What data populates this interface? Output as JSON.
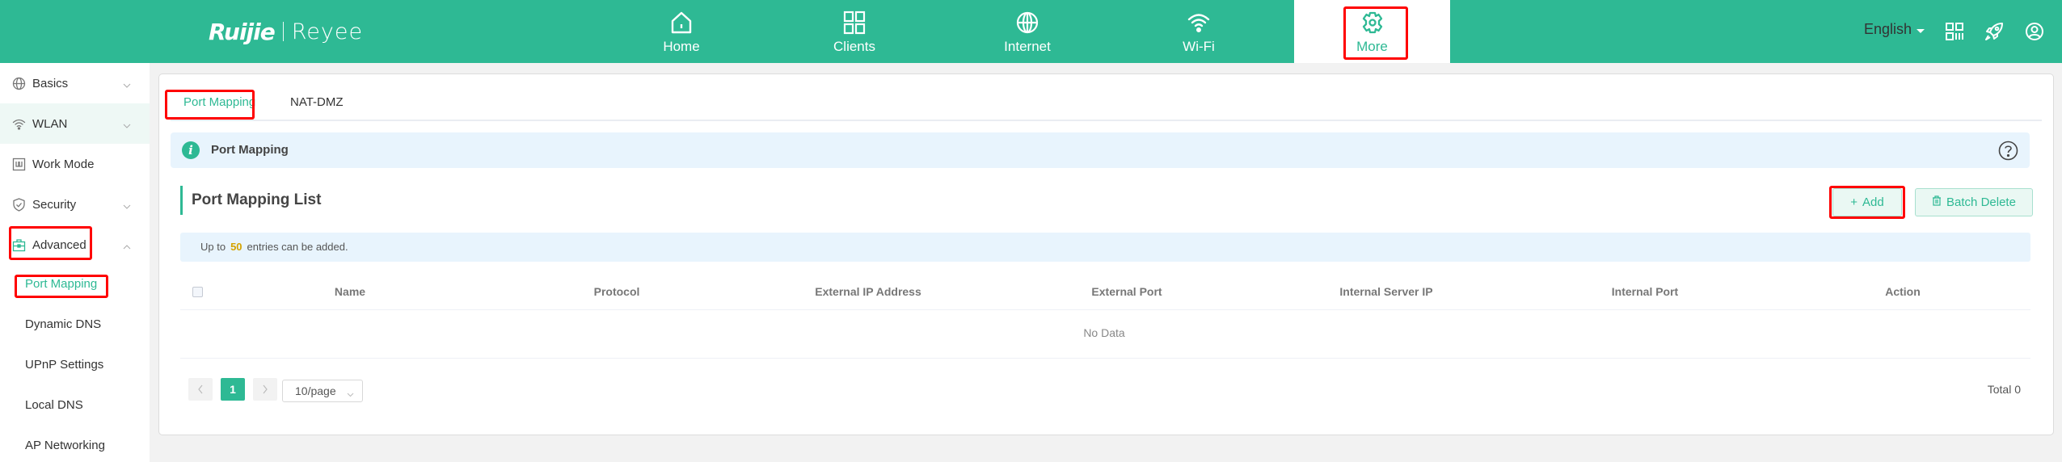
{
  "header": {
    "brand_primary": "Ruijie",
    "brand_secondary": "Reyee",
    "nav": [
      {
        "label": "Home",
        "icon": "home-icon"
      },
      {
        "label": "Clients",
        "icon": "clients-grid-icon"
      },
      {
        "label": "Internet",
        "icon": "globe-icon"
      },
      {
        "label": "Wi-Fi",
        "icon": "wifi-icon"
      },
      {
        "label": "More",
        "icon": "gear-icon",
        "active": true
      }
    ],
    "language": "English",
    "right_icons": [
      "qr-code-icon",
      "rocket-icon",
      "user-icon"
    ]
  },
  "sidebar": {
    "items": [
      {
        "label": "Basics",
        "icon": "globe-icon",
        "expandable": true,
        "expanded": false
      },
      {
        "label": "WLAN",
        "icon": "wifi-icon",
        "expandable": true,
        "expanded": false,
        "hovered": true
      },
      {
        "label": "Work Mode",
        "icon": "work-mode-icon",
        "expandable": false
      },
      {
        "label": "Security",
        "icon": "shield-icon",
        "expandable": true,
        "expanded": false
      },
      {
        "label": "Advanced",
        "icon": "toolbox-icon",
        "expandable": true,
        "expanded": true
      }
    ],
    "sub_items": [
      {
        "label": "Port Mapping",
        "active": true
      },
      {
        "label": "Dynamic DNS"
      },
      {
        "label": "UPnP Settings"
      },
      {
        "label": "Local DNS"
      },
      {
        "label": "AP Networking"
      }
    ]
  },
  "main": {
    "tabs": [
      {
        "label": "Port Mapping",
        "active": true
      },
      {
        "label": "NAT-DMZ"
      }
    ],
    "info_title": "Port Mapping",
    "section_title": "Port Mapping List",
    "buttons": {
      "add": "Add",
      "batch_delete": "Batch Delete"
    },
    "limit": {
      "prefix": "Up to",
      "count": "50",
      "suffix": "entries can be added."
    },
    "table": {
      "columns": [
        "Name",
        "Protocol",
        "External IP Address",
        "External Port",
        "Internal Server IP",
        "Internal Port",
        "Action"
      ],
      "rows": [],
      "empty_text": "No Data"
    },
    "pagination": {
      "current_page": "1",
      "page_size": "10/page",
      "total": "Total 0"
    }
  },
  "colors": {
    "brand": "#2eb994",
    "highlight": "#ff0000",
    "limit_number": "#d4a200",
    "info_bg": "#e8f4fd"
  }
}
